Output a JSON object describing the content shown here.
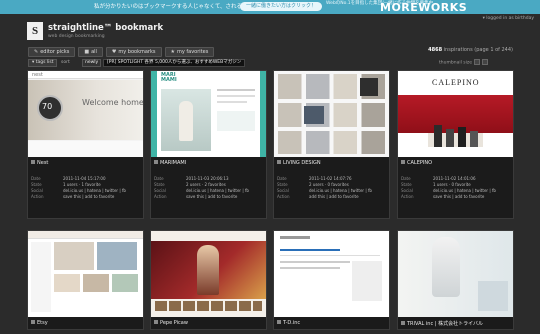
{
  "banner": {
    "text": "私が分かりたいのはブックマークする人じゃなくて、される人。",
    "cta": "一緒に働きたい方はクリック！",
    "small": "WebのNo.1を目指した集団/一緒に作る仲間を募集中",
    "logo": "MOREWORKS"
  },
  "login": "▾ logged in as birthday",
  "brand": {
    "letter": "S",
    "title": "straightline™ bookmark",
    "sub": "web design bookmarking"
  },
  "nav": [
    {
      "icon": "✎",
      "label": "editor picks"
    },
    {
      "icon": "■",
      "label": "all"
    },
    {
      "icon": "♥",
      "label": "my bookmarks"
    },
    {
      "icon": "★",
      "label": "my favorites"
    }
  ],
  "count": {
    "number": "4868",
    "rest": "inspirations (page 1 of 244)"
  },
  "toolbar": {
    "tags": "▾ tags list",
    "sort": "sort",
    "sort_value": "newly",
    "ad": "[PR] SPOTLIGHT 各界 5,000人から選ぶ、おすすめWEBマガジン",
    "thumb": "thumbnail size"
  },
  "labels": {
    "date": "Date",
    "state": "State",
    "social": "Social",
    "action": "Action"
  },
  "cards": [
    {
      "title": "Nest",
      "date": "2011-11-04 15:17:00",
      "state": "1 users · 1 favorite",
      "social": "del.icio.us | hatena | twitter | fb",
      "action": "save this | add to favorite",
      "shot": "nest"
    },
    {
      "title": "MARIMAMI",
      "date": "2011-11-03 20:06:13",
      "state": "2 users · 2 favorites",
      "social": "del.icio.us | hatena | twitter | fb",
      "action": "save this | add to favorite",
      "shot": "mari"
    },
    {
      "title": "LIVING DESIGN",
      "date": "2011-11-02 14:07:76",
      "state": "2 users · 0 favorites",
      "social": "del.icio.us | hatena | twitter | fb",
      "action": "add this | add to favorite",
      "shot": "living"
    },
    {
      "title": "CALEPINO",
      "date": "2011-11-02 14:01:06",
      "state": "1 users · 0 favorite",
      "social": "del.icio.us | hatena | twitter | fb",
      "action": "save this | add to favorite",
      "shot": "calepino"
    },
    {
      "title": "Etsy",
      "shot": "etsy"
    },
    {
      "title": "Pepe Picaw",
      "shot": "pepe"
    },
    {
      "title": "T-D.inc",
      "shot": "td"
    },
    {
      "title": "TRIVAL inc | 株式会社トライバル",
      "shot": "trival"
    }
  ],
  "shots": {
    "nest_heading": "Welcome home",
    "nest_brand": "nest",
    "nest_temp": "70",
    "calepino_brand": "CALEPINO",
    "mari_logo": "MARI MAMI"
  }
}
